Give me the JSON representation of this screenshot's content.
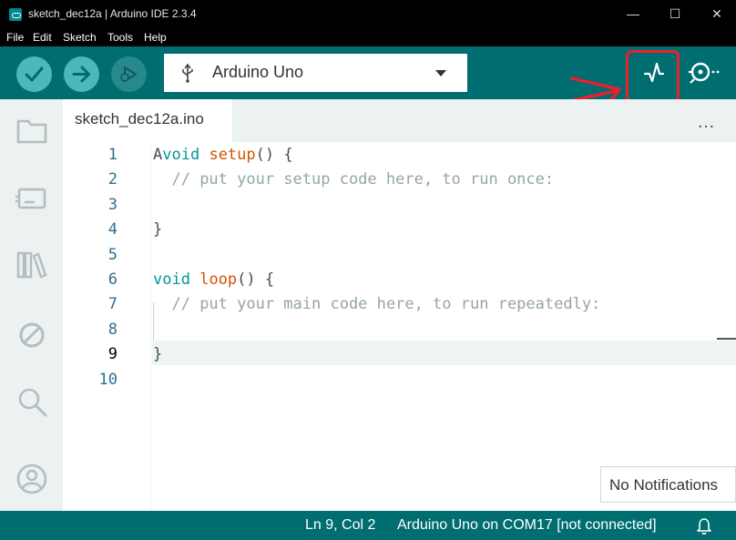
{
  "window": {
    "title": "sketch_dec12a | Arduino IDE 2.3.4",
    "minimize_glyph": "—",
    "maximize_glyph": "☐",
    "close_glyph": "✕"
  },
  "menu": {
    "items": [
      "File",
      "Edit",
      "Sketch",
      "Tools",
      "Help"
    ]
  },
  "toolbar": {
    "board": "Arduino Uno",
    "icons": [
      "verify-icon",
      "upload-icon",
      "debug-icon",
      "usb-icon",
      "serial-plotter-icon",
      "serial-monitor-icon"
    ]
  },
  "tabs": {
    "active": "sketch_dec12a.ino",
    "more": "…"
  },
  "editor": {
    "line_numbers": [
      "1",
      "2",
      "3",
      "4",
      "5",
      "6",
      "7",
      "8",
      "9",
      "10"
    ],
    "lines": [
      {
        "prefix": "A",
        "kw": "void",
        "sp": " ",
        "fn": "setup",
        "rest": "() {",
        "comment": ""
      },
      {
        "prefix": "  ",
        "kw": "",
        "sp": "",
        "fn": "",
        "rest": "",
        "comment": "// put your setup code here, to run once:"
      },
      {
        "prefix": "",
        "kw": "",
        "sp": "",
        "fn": "",
        "rest": "",
        "comment": ""
      },
      {
        "prefix": "",
        "kw": "",
        "sp": "",
        "fn": "",
        "rest": "}",
        "comment": ""
      },
      {
        "prefix": "",
        "kw": "",
        "sp": "",
        "fn": "",
        "rest": "",
        "comment": ""
      },
      {
        "prefix": "",
        "kw": "void",
        "sp": " ",
        "fn": "loop",
        "rest": "() {",
        "comment": ""
      },
      {
        "prefix": "  ",
        "kw": "",
        "sp": "",
        "fn": "",
        "rest": "",
        "comment": "// put your main code here, to run repeatedly:"
      },
      {
        "prefix": "",
        "kw": "",
        "sp": "",
        "fn": "",
        "rest": "",
        "comment": ""
      },
      {
        "prefix": "",
        "kw": "",
        "sp": "",
        "fn": "",
        "rest": "}",
        "comment": ""
      },
      {
        "prefix": "",
        "kw": "",
        "sp": "",
        "fn": "",
        "rest": "",
        "comment": ""
      }
    ],
    "active_line": "9"
  },
  "notification": {
    "text": "No Notifications"
  },
  "status": {
    "position": "Ln 9, Col 2",
    "board_port": "Arduino Uno on COM17 [not connected]"
  },
  "colors": {
    "accent": "#006d70",
    "button": "#4db7bb",
    "annotation": "#e8202e"
  }
}
